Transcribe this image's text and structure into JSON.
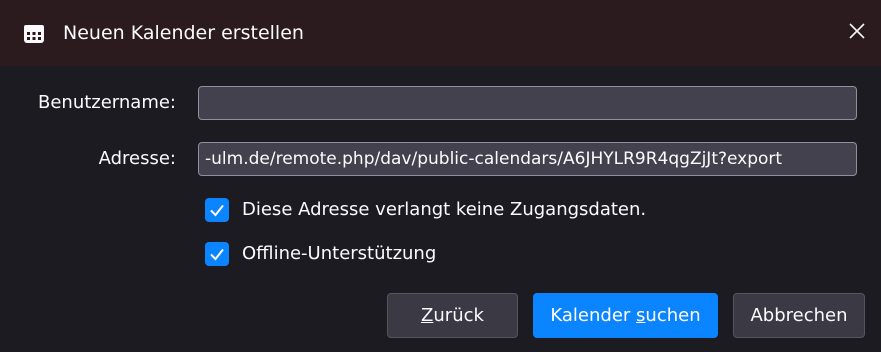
{
  "dialog": {
    "title": "Neuen Kalender erstellen",
    "title_icon": "calendar-icon",
    "close_icon": "close-icon"
  },
  "form": {
    "username_label": "Benutzername:",
    "username_value": "",
    "address_label": "Adresse:",
    "address_value": "-ulm.de/remote.php/dav/public-calendars/A6JHYLR9R4qgZjJt?export"
  },
  "options": {
    "no_credentials": {
      "label": "Diese Adresse verlangt keine Zugangsdaten.",
      "checked": true
    },
    "offline_support": {
      "label": "Offline-Unterstützung",
      "checked": true
    }
  },
  "buttons": {
    "back": {
      "access_key": "Z",
      "rest": "urück"
    },
    "search": {
      "before": "Kalender ",
      "access_key": "s",
      "after": "uchen"
    },
    "cancel": "Abbrechen"
  },
  "colors": {
    "accent": "#0a84ff",
    "titlebar": "#2b1a1e",
    "background": "#1c1b22",
    "field": "#42414d"
  }
}
